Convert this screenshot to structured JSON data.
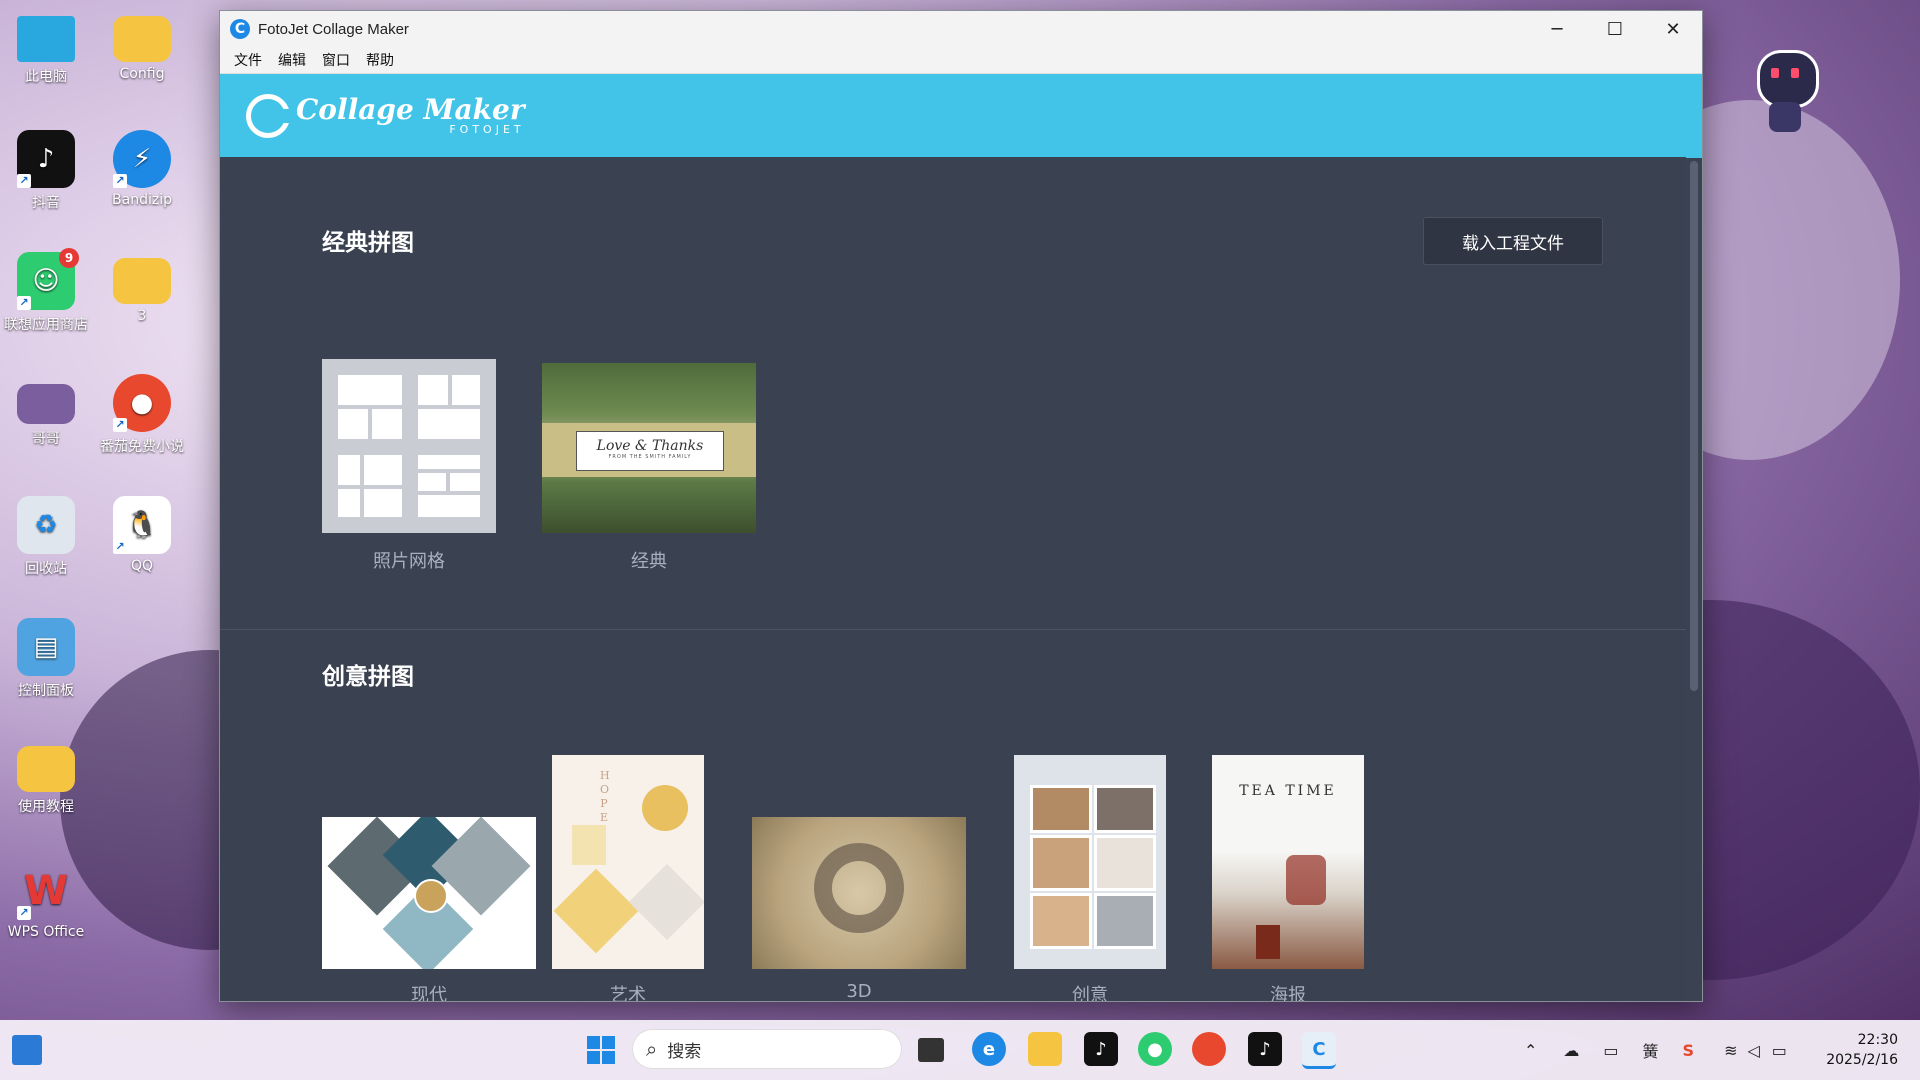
{
  "desktop": {
    "icons": [
      {
        "label": "此电脑",
        "icon": "monitor-icon"
      },
      {
        "label": "Config",
        "icon": "folder-icon"
      },
      {
        "label": "抖音",
        "icon": "tiktok-icon"
      },
      {
        "label": "Bandizip",
        "icon": "bandizip-icon"
      },
      {
        "label": "联想应用商店",
        "icon": "lenovo-store-icon",
        "badge": "9"
      },
      {
        "label": "3",
        "icon": "folder-icon"
      },
      {
        "label": "哥哥",
        "icon": "image-icon"
      },
      {
        "label": "番茄免费小说",
        "icon": "novel-icon"
      },
      {
        "label": "回收站",
        "icon": "recycle-bin-icon"
      },
      {
        "label": "QQ",
        "icon": "qq-icon"
      },
      {
        "label": "控制面板",
        "icon": "control-panel-icon"
      },
      {
        "label": "使用教程",
        "icon": "folder-icon"
      },
      {
        "label": "WPS Office",
        "icon": "wps-icon"
      }
    ]
  },
  "window": {
    "title": "FotoJet Collage Maker",
    "controls": {
      "minimize": "─",
      "maximize": "☐",
      "close": "✕"
    },
    "menu": [
      "文件",
      "编辑",
      "窗口",
      "帮助"
    ],
    "logo": {
      "main": "Collage Maker",
      "sub": "FOTOJET"
    },
    "load_button": "载入工程文件",
    "sections": {
      "classic": {
        "title": "经典拼图",
        "items": [
          {
            "label": "照片网格"
          },
          {
            "label": "经典",
            "caption": "Love & Thanks",
            "subcaption": "FROM THE SMITH FAMILY"
          }
        ]
      },
      "creative": {
        "title": "创意拼图",
        "items": [
          {
            "label": "现代"
          },
          {
            "label": "艺术",
            "caption": "HOPE"
          },
          {
            "label": "3D"
          },
          {
            "label": "创意"
          },
          {
            "label": "海报",
            "caption": "TEA TIME"
          }
        ]
      }
    }
  },
  "taskbar": {
    "search_placeholder": "搜索",
    "clock": {
      "time": "22:30",
      "date": "2025/2/16"
    },
    "tray": {
      "ime": "簧"
    }
  },
  "colors": {
    "banner": "#42c3e8",
    "content_bg": "#3a4150",
    "label": "#a8afbd"
  }
}
